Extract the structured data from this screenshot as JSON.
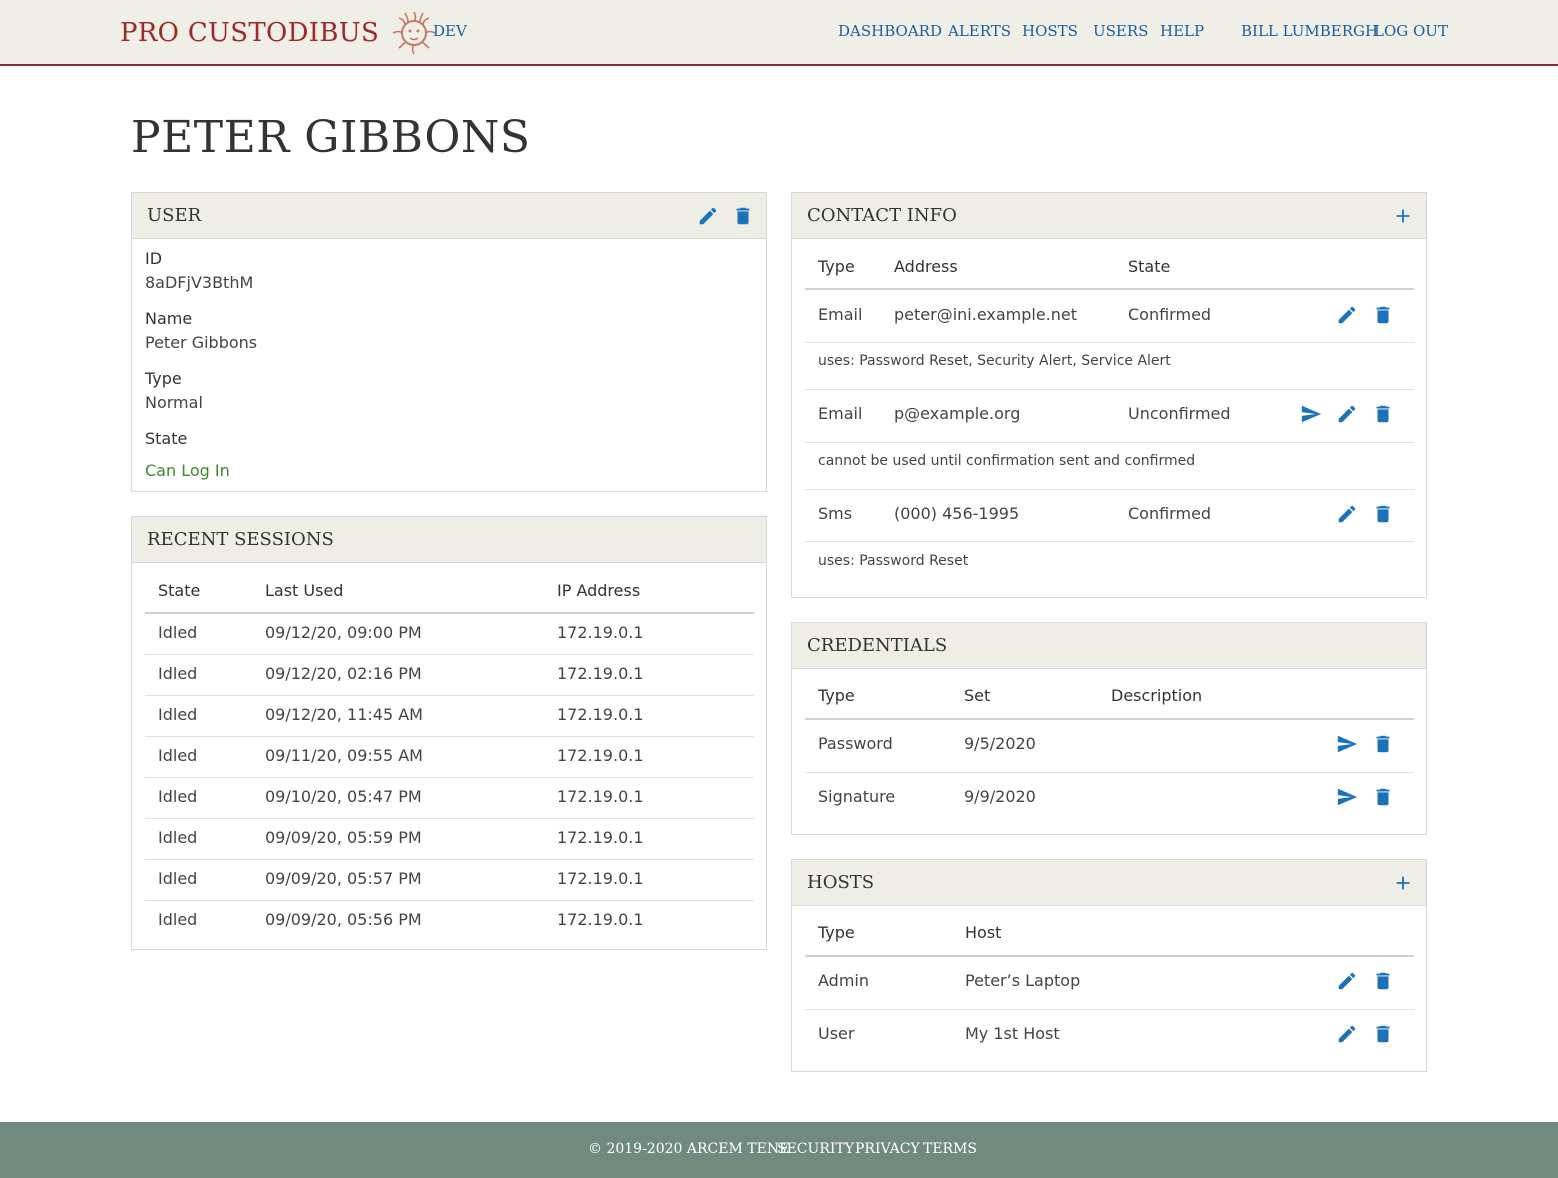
{
  "header": {
    "brand": "PRO CUSTODIBUS",
    "env": "DEV",
    "nav": [
      "DASHBOARD",
      "ALERTS",
      "HOSTS",
      "USERS",
      "HELP"
    ],
    "user": "BILL LUMBERGH",
    "logout": "LOG OUT"
  },
  "page_title": "PETER GIBBONS",
  "user_panel": {
    "title": "USER",
    "fields": [
      {
        "label": "ID",
        "value": "8aDFjV3BthM"
      },
      {
        "label": "Name",
        "value": "Peter Gibbons"
      },
      {
        "label": "Type",
        "value": "Normal"
      },
      {
        "label": "State",
        "value": "Can Log In"
      }
    ]
  },
  "sessions_panel": {
    "title": "RECENT SESSIONS",
    "columns": [
      "State",
      "Last Used",
      "IP Address"
    ],
    "rows": [
      [
        "Idled",
        "09/12/20, 09:00 PM",
        "172.19.0.1"
      ],
      [
        "Idled",
        "09/12/20, 02:16 PM",
        "172.19.0.1"
      ],
      [
        "Idled",
        "09/12/20, 11:45 AM",
        "172.19.0.1"
      ],
      [
        "Idled",
        "09/11/20, 09:55 AM",
        "172.19.0.1"
      ],
      [
        "Idled",
        "09/10/20, 05:47 PM",
        "172.19.0.1"
      ],
      [
        "Idled",
        "09/09/20, 05:59 PM",
        "172.19.0.1"
      ],
      [
        "Idled",
        "09/09/20, 05:57 PM",
        "172.19.0.1"
      ],
      [
        "Idled",
        "09/09/20, 05:56 PM",
        "172.19.0.1"
      ]
    ]
  },
  "contact_panel": {
    "title": "CONTACT INFO",
    "columns": [
      "Type",
      "Address",
      "State"
    ],
    "rows": [
      {
        "type": "Email",
        "address": "peter@ini.example.net",
        "state": "Confirmed",
        "note": "uses: Password Reset, Security Alert, Service Alert"
      },
      {
        "type": "Email",
        "address": "p@example.org",
        "state": "Unconfirmed",
        "note": "cannot be used until confirmation sent and confirmed"
      },
      {
        "type": "Sms",
        "address": "(000) 456-1995",
        "state": "Confirmed",
        "note": "uses: Password Reset"
      }
    ]
  },
  "credentials_panel": {
    "title": "CREDENTIALS",
    "columns": [
      "Type",
      "Set",
      "Description"
    ],
    "rows": [
      {
        "type": "Password",
        "set": "9/5/2020",
        "description": ""
      },
      {
        "type": "Signature",
        "set": "9/9/2020",
        "description": ""
      }
    ]
  },
  "hosts_panel": {
    "title": "HOSTS",
    "columns": [
      "Type",
      "Host"
    ],
    "rows": [
      {
        "type": "Admin",
        "host": "Peter’s Laptop"
      },
      {
        "type": "User",
        "host": "My 1st Host"
      }
    ]
  },
  "footer": {
    "copyright": "© 2019-2020 ARCEM TENE",
    "links": [
      "SECURITY",
      "PRIVACY",
      "TERMS"
    ]
  },
  "colors": {
    "accent": "#1b72b8",
    "brand": "#9c2a2a",
    "confirmed": "#3d8a2a",
    "unconfirmed": "#c9b21a",
    "footer": "#718a80"
  }
}
